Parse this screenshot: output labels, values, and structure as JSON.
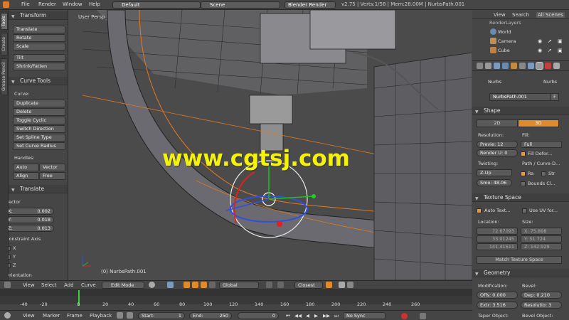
{
  "topbar": {
    "menus": [
      "File",
      "Render",
      "Window",
      "Help"
    ],
    "layout": "Default",
    "scene": "Scene",
    "engine": "Blender Render",
    "info": "v2.75 | Verts:1/58 | Mem:28.00M | NurbsPath.001"
  },
  "side_tabs": [
    "Tools",
    "Create",
    "Grease Pencil"
  ],
  "toolshelf": {
    "transform": {
      "title": "Transform",
      "buttons": [
        "Translate",
        "Rotate",
        "Scale",
        "Tilt",
        "Shrink/Fatten"
      ]
    },
    "curve_tools": {
      "title": "Curve Tools",
      "curve_label": "Curve:",
      "buttons": [
        "Duplicate",
        "Delete",
        "Toggle Cyclic",
        "Switch Direction",
        "Set Spline Type",
        "Set Curve Radius"
      ],
      "handles_label": "Handles:",
      "handles": [
        "Auto",
        "Vector",
        "Align",
        "Free"
      ]
    },
    "translate_op": {
      "title": "Translate",
      "vector_label": "Vector",
      "x": "X:",
      "x_val": "0.002",
      "y": "Y:",
      "y_val": "0.018",
      "z": "Z:",
      "z_val": "0.013",
      "constraint_label": "Constraint Axis",
      "cx": "X",
      "cy": "Y",
      "cz": "Z",
      "orientation": "Orientation"
    }
  },
  "viewport": {
    "label": "User Persp",
    "object": "(0) NurbsPath.001",
    "watermark": "www.cgtsj.com"
  },
  "outliner": {
    "menus": [
      "View",
      "Search",
      "All Scenes"
    ],
    "items": [
      "RenderLayers",
      "World",
      "Camera",
      "Cube"
    ]
  },
  "props": {
    "tab1": "Nurbs",
    "tab2": "Nurbs",
    "name": "NurbsPath.001",
    "f_btn": "F",
    "shape": {
      "title": "Shape",
      "b2d": "2D",
      "b3d": "3D",
      "resolution": "Resolution:",
      "fill": "Fill:",
      "preview": "Previe: 12",
      "render": "Render U: 0",
      "fill_val": "Full",
      "fill_deform": "Fill Defor...",
      "twisting": "Twisting:",
      "path_curve": "Path / Curve-D...",
      "zup": "Z-Up",
      "radius": "Ra",
      "stretch": "Str",
      "smooth": "Smo: 48.06",
      "bounds": "Bounds Cl..."
    },
    "texture_space": {
      "title": "Texture Space",
      "auto": "Auto Text...",
      "use_uv": "Use UV for...",
      "location": "Location:",
      "size": "Size:",
      "lx": "72.67093",
      "ly": "33.01245",
      "lz": "141.41611",
      "sx": "X: 75.898",
      "sy": "Y: 51.724",
      "sz": "Z: 142.929",
      "match": "Match Texture Space"
    },
    "geometry": {
      "title": "Geometry",
      "modification": "Modification:",
      "bevel": "Bevel:",
      "offs": "Offs: 0.000",
      "dep": "Dep: 0.210",
      "extr": "Extr: 3.516",
      "resol": "Resolutio: 3",
      "taper": "Taper Object:",
      "bevel_obj": "Bevel Object:"
    }
  },
  "header3d": {
    "view": "View",
    "select": "Select",
    "add": "Add",
    "curve": "Curve",
    "mode": "Edit Mode",
    "orientation": "Global",
    "snap": "Closest"
  },
  "timeline": {
    "ticks": [
      "-40",
      "-20",
      "0",
      "20",
      "40",
      "60",
      "80",
      "100",
      "120",
      "140",
      "160",
      "180",
      "200",
      "220",
      "240",
      "260"
    ]
  },
  "timeline_hdr": {
    "view": "View",
    "marker": "Marker",
    "frame": "Frame",
    "playback": "Playback",
    "start": "Start:",
    "start_val": "1",
    "end": "End:",
    "end_val": "250",
    "current": "0",
    "sync": "No Sync"
  }
}
